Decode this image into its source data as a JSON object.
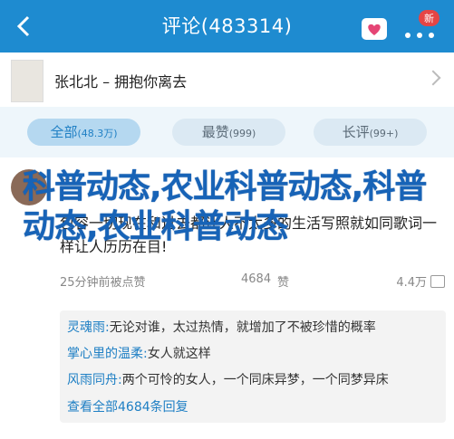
{
  "header": {
    "title": "评论(483314)",
    "badge": "新"
  },
  "book": {
    "title": "张北北 – 拥抱你离去"
  },
  "tabs": [
    {
      "label": "全部",
      "count": "(48.3万)"
    },
    {
      "label": "最赞",
      "count": "(999)"
    },
    {
      "label": "长评",
      "count": "(99+)"
    }
  ],
  "overlay_text": "科普动态,农业科普动态,科普动态,农业科普动态",
  "comment": {
    "user": "一",
    "text": "包容一切现在和过去都让人不太多的生活写照就如同歌词一样让人历历在目!",
    "time": "25分钟前被点赞",
    "mid": "4684",
    "like_label": "赞",
    "likes": "4.4万"
  },
  "replies": [
    {
      "name": "灵魂雨:",
      "text": "无论对谁，太过热情，就增加了不被珍惜的概率"
    },
    {
      "name": "掌心里的温柔:",
      "text": "女人就这样"
    },
    {
      "name": "风雨同舟:",
      "text": "两个可怜的女人，一个同床异梦，一个同梦异床"
    }
  ],
  "view_all": "查看全部4684条回复"
}
